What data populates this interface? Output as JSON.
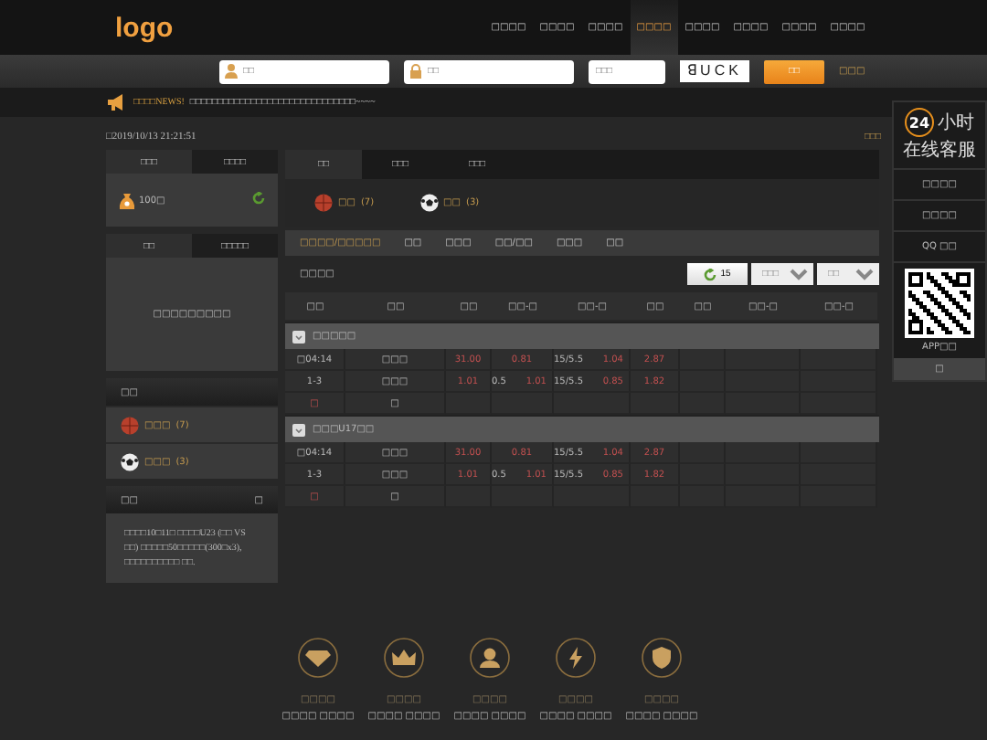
{
  "header": {
    "logo": "logo",
    "nav": [
      {
        "label": "□□□□",
        "selected": false
      },
      {
        "label": "□□□□",
        "selected": false
      },
      {
        "label": "□□□□",
        "selected": false
      },
      {
        "label": "□□□□",
        "selected": true
      },
      {
        "label": "□□□□",
        "selected": false
      },
      {
        "label": "□□□□",
        "selected": false
      },
      {
        "label": "□□□□",
        "selected": false
      },
      {
        "label": "□□□□",
        "selected": false
      }
    ]
  },
  "login": {
    "username": {
      "placeholder": "□□"
    },
    "password": {
      "placeholder": "□□"
    },
    "code": {
      "placeholder": "□□□"
    },
    "captcha": "ꓭUCK",
    "button": "□□",
    "link": "□□□"
  },
  "news": {
    "label": "□□□□NEWS!",
    "text": "□□□□□□□□□□□□□□□□□□□□□□□□□□□□□□~~~~"
  },
  "datetime": "□2019/10/13 21:21:51",
  "top_link": "□□□",
  "sidebar": {
    "account": {
      "tabs": [
        {
          "label": "□□□",
          "selected": true
        },
        {
          "label": "□□□□",
          "selected": false
        }
      ],
      "balance": "100□"
    },
    "bets": {
      "tabs": [
        {
          "label": "□□",
          "selected": true
        },
        {
          "label": "□□□□□",
          "selected": false
        }
      ],
      "message": "□□□□□□□□□"
    },
    "sports": {
      "title": "□□",
      "items": [
        {
          "kind": "basketball",
          "name": "□□□",
          "count": "(7)"
        },
        {
          "kind": "soccer",
          "name": "□□□",
          "count": "(3)"
        }
      ]
    },
    "notice": {
      "title": "□□",
      "more": "□",
      "text": "□□□□10□11□ □□□□U23 (□□ VS □□) □□□□□50□□□□□(300□x3), □□□□□□□□□□ □□."
    }
  },
  "main": {
    "tabs": [
      {
        "label": "□□",
        "selected": true
      },
      {
        "label": "□□□",
        "selected": false
      },
      {
        "label": "□□□",
        "selected": false
      }
    ],
    "sports": [
      {
        "kind": "basketball",
        "name": "□□",
        "count": "(7)"
      },
      {
        "kind": "soccer",
        "name": "□□",
        "count": "(3)"
      }
    ],
    "filters": [
      {
        "label": "□□□□/□□□□□",
        "selected": true
      },
      {
        "label": "□□",
        "selected": false
      },
      {
        "label": "□□□",
        "selected": false
      },
      {
        "label": "□□/□□",
        "selected": false
      },
      {
        "label": "□□□",
        "selected": false
      },
      {
        "label": "□□",
        "selected": false
      }
    ],
    "toolbar": {
      "title": "□□□□",
      "refresh": "15",
      "select_1": "□□□",
      "select_2": "□□"
    },
    "table": {
      "columns": [
        "□□",
        "□□",
        "□□",
        "□□-□",
        "□□-□",
        "□□",
        "□□",
        "□□-□",
        "□□-□"
      ],
      "leagues": [
        {
          "name": "□□□□□",
          "rows": [
            [
              {
                "text": "□04:14"
              },
              {
                "text": "□□□"
              },
              {
                "odds": "31.00"
              },
              {
                "odds": "0.81"
              },
              {
                "text": "15/5.5",
                "odds": "1.04"
              },
              {
                "odds": "2.87"
              },
              {},
              {},
              {}
            ],
            [
              {
                "text": "1-3"
              },
              {
                "text": "□□□"
              },
              {
                "odds": "1.01"
              },
              {
                "text": "0.5",
                "odds": "1.01"
              },
              {
                "text": "15/5.5",
                "odds": "0.85"
              },
              {
                "odds": "1.82"
              },
              {},
              {},
              {}
            ],
            [
              {
                "odds": "□"
              },
              {
                "text": "□"
              },
              {},
              {},
              {},
              {},
              {},
              {},
              {}
            ]
          ]
        },
        {
          "name": "□□□U17□□",
          "rows": [
            [
              {
                "text": "□04:14"
              },
              {
                "text": "□□□"
              },
              {
                "odds": "31.00"
              },
              {
                "odds": "0.81"
              },
              {
                "text": "15/5.5",
                "odds": "1.04"
              },
              {
                "odds": "2.87"
              },
              {},
              {},
              {}
            ],
            [
              {
                "text": "1-3"
              },
              {
                "text": "□□□"
              },
              {
                "odds": "1.01"
              },
              {
                "text": "0.5",
                "odds": "1.01"
              },
              {
                "text": "15/5.5",
                "odds": "0.85"
              },
              {
                "odds": "1.82"
              },
              {},
              {},
              {}
            ],
            [
              {
                "odds": "□"
              },
              {
                "text": "□"
              },
              {},
              {},
              {},
              {},
              {},
              {},
              {}
            ]
          ]
        }
      ]
    }
  },
  "service_panel": {
    "badge": "24",
    "line_1": "小时",
    "line_2": "在线客服",
    "links": [
      "□□□□",
      "□□□□",
      "QQ □□"
    ],
    "app_label": "APP□□",
    "bottom": "□"
  },
  "features": [
    {
      "kind": "diamond",
      "title": "□□□□",
      "subtitle": "□□□□ □□□□"
    },
    {
      "kind": "crown",
      "title": "□□□□",
      "subtitle": "□□□□ □□□□"
    },
    {
      "kind": "person",
      "title": "□□□□",
      "subtitle": "□□□□ □□□□"
    },
    {
      "kind": "bolt",
      "title": "□□□□",
      "subtitle": "□□□□ □□□□"
    },
    {
      "kind": "shield",
      "title": "□□□□",
      "subtitle": "□□□□ □□□□"
    }
  ]
}
